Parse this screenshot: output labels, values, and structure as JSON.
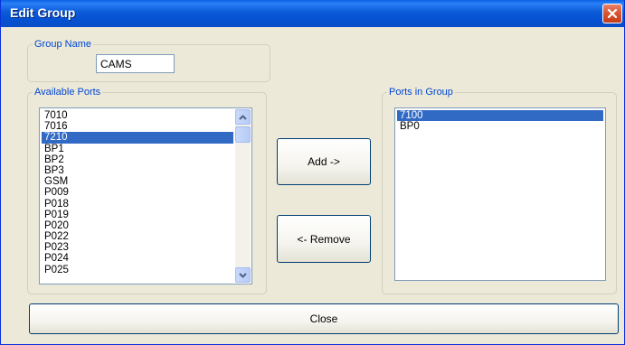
{
  "window": {
    "title": "Edit Group"
  },
  "group_name": {
    "legend": "Group Name",
    "value": "CAMS"
  },
  "available_ports": {
    "legend": "Available Ports",
    "items": [
      {
        "label": "7010",
        "selected": false
      },
      {
        "label": "7016",
        "selected": false
      },
      {
        "label": "7210",
        "selected": true
      },
      {
        "label": "BP1",
        "selected": false
      },
      {
        "label": "BP2",
        "selected": false
      },
      {
        "label": "BP3",
        "selected": false
      },
      {
        "label": "GSM",
        "selected": false
      },
      {
        "label": "P009",
        "selected": false
      },
      {
        "label": "P018",
        "selected": false
      },
      {
        "label": "P019",
        "selected": false
      },
      {
        "label": "P020",
        "selected": false
      },
      {
        "label": "P022",
        "selected": false
      },
      {
        "label": "P023",
        "selected": false
      },
      {
        "label": "P024",
        "selected": false
      },
      {
        "label": "P025",
        "selected": false
      }
    ]
  },
  "ports_in_group": {
    "legend": "Ports in Group",
    "items": [
      {
        "label": "7100",
        "selected": true
      },
      {
        "label": "BP0",
        "selected": false
      }
    ]
  },
  "buttons": {
    "add": "Add ->",
    "remove": "<- Remove",
    "close": "Close"
  },
  "colors": {
    "title_bar": "#0552d3",
    "selection": "#316ac5",
    "legend_text": "#0046d5",
    "dialog_bg": "#ece9d8"
  },
  "icons": {
    "close": "close-icon",
    "scroll_up": "chevron-up-icon",
    "scroll_down": "chevron-down-icon"
  }
}
